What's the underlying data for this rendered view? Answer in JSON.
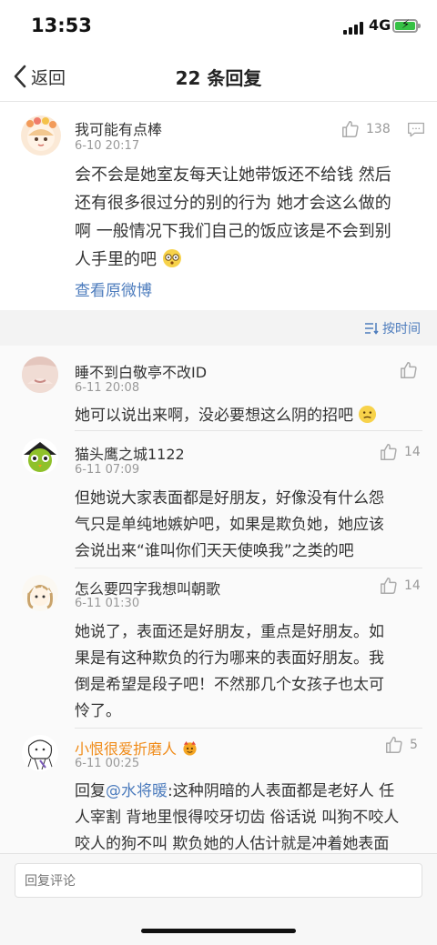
{
  "status_bar": {
    "time": "13:53",
    "network": "4G"
  },
  "nav": {
    "back_label": "返回",
    "title": "22 条回复"
  },
  "main_comment": {
    "username": "我可能有点棒",
    "time": "6-10 20:17",
    "likes": "138",
    "text_lines": [
      "会不会是她室友每天让她带饭还不给钱 然后",
      "还有很多很过分的别的行为 她才会这么做的",
      "啊 一般情况下我们自己的饭应该是不会到别",
      "人手里的吧"
    ],
    "view_original": "查看原微博"
  },
  "sort_label": "按时间",
  "replies": [
    {
      "username": "睡不到白敬亭不改ID",
      "time": "6-11 20:08",
      "likes": "",
      "lines": [
        "她可以说出来啊，没必要想这么阴的招吧"
      ]
    },
    {
      "username": "猫头鹰之城1122",
      "time": "6-11 07:09",
      "likes": "14",
      "lines": [
        "但她说大家表面都是好朋友，好像没有什么怨",
        "气只是单纯地嫉妒吧，如果是欺负她，她应该",
        "会说出来“谁叫你们天天使唤我”之类的吧"
      ]
    },
    {
      "username": "怎么要四字我想叫朝歌",
      "time": "6-11 01:30",
      "likes": "14",
      "lines": [
        "她说了，表面还是好朋友，重点是好朋友。如",
        "果是有这种欺负的行为哪来的表面好朋友。我",
        "倒是希望是段子吧！不然那几个女孩子也太可",
        "怜了。"
      ]
    },
    {
      "username": "小恨很爱折磨人",
      "time": "6-11 00:25",
      "likes": "5",
      "reply_prefix": "回复",
      "mention": "@水将暖",
      "lines": [
        ":这种阴暗的人表面都是老好人 任",
        "人宰割 背地里恨得咬牙切齿 俗话说 叫狗不咬人",
        "咬人的狗不叫 欺负她的人估计就是冲着她表面"
      ]
    }
  ],
  "input": {
    "placeholder": "回复评论"
  },
  "colors": {
    "link": "#4d7cbd",
    "vip_name": "#f08a16",
    "muted": "#999999"
  },
  "icons": [
    "back-chevron-icon",
    "thumb-up-icon",
    "comment-icon",
    "sort-icon",
    "emoji-icon",
    "badge-icon"
  ]
}
